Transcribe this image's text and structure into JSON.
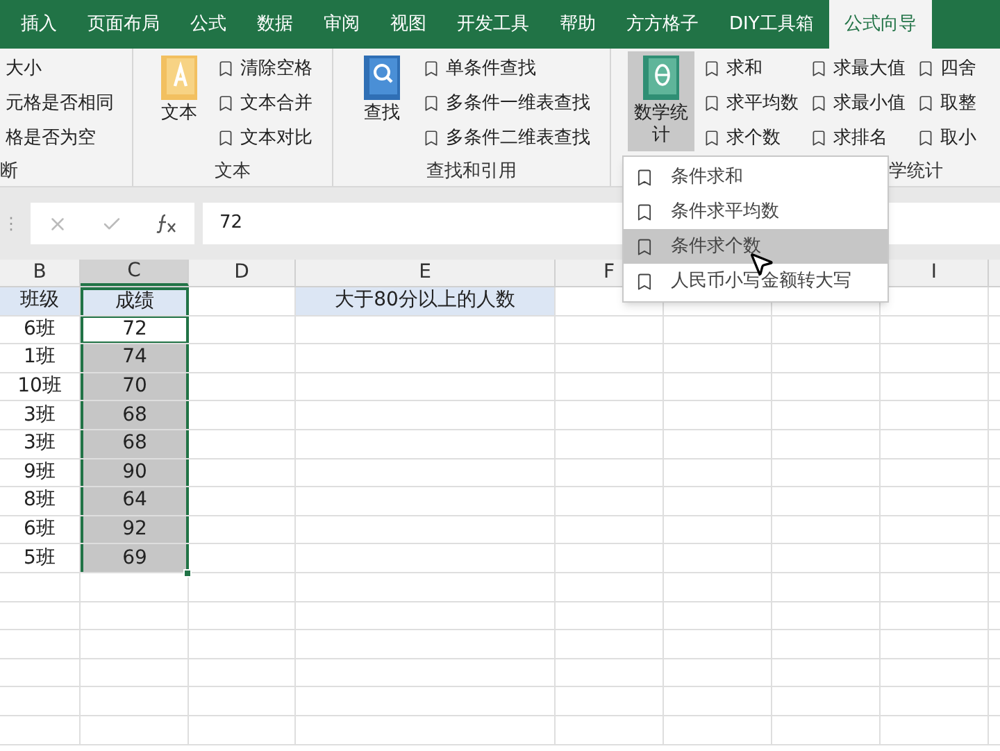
{
  "tabs": [
    {
      "label": "插入",
      "selected": false
    },
    {
      "label": "页面布局",
      "selected": false
    },
    {
      "label": "公式",
      "selected": false
    },
    {
      "label": "数据",
      "selected": false
    },
    {
      "label": "审阅",
      "selected": false
    },
    {
      "label": "视图",
      "selected": false
    },
    {
      "label": "开发工具",
      "selected": false
    },
    {
      "label": "帮助",
      "selected": false
    },
    {
      "label": "方方格子",
      "selected": false
    },
    {
      "label": "DIY工具箱",
      "selected": false
    },
    {
      "label": "公式向导",
      "selected": true
    }
  ],
  "ribbon": {
    "groups": [
      {
        "label": "断",
        "columns": [
          [
            "大小",
            "元格是否相同",
            "格是否为空"
          ]
        ],
        "plain": true
      },
      {
        "label": "文本",
        "big": {
          "label": "文本",
          "kind": "text",
          "pressed": false
        },
        "columns": [
          [
            "清除空格",
            "文本合并",
            "文本对比"
          ]
        ]
      },
      {
        "label": "查找和引用",
        "big": {
          "label": "查找",
          "kind": "search",
          "pressed": false
        },
        "columns": [
          [
            "单条件查找",
            "多条件一维表查找",
            "多条件二维表查找"
          ]
        ]
      },
      {
        "label": "学统计",
        "big": {
          "label": "数学统",
          "label2": "计",
          "kind": "theta",
          "pressed": true
        },
        "columns": [
          [
            "求和",
            "求平均数",
            "求个数"
          ],
          [
            "求最大值",
            "求最小值",
            "求排名"
          ],
          [
            "四舍",
            "取整",
            "取小"
          ]
        ]
      }
    ]
  },
  "formula_bar": {
    "grip": "⋮",
    "value": "72"
  },
  "columns": [
    {
      "label": "B",
      "selected": false
    },
    {
      "label": "C",
      "selected": true
    },
    {
      "label": "D",
      "selected": false
    },
    {
      "label": "E",
      "selected": false
    },
    {
      "label": "F",
      "selected": false
    },
    {
      "label": "I",
      "selected": false
    }
  ],
  "rows": [
    {
      "b": {
        "text": "班级",
        "highlight": true
      },
      "c": {
        "text": "成绩",
        "highlight": true,
        "selected": true,
        "active": false
      },
      "e": {
        "text": "大于80分以上的人数",
        "highlight": true
      }
    },
    {
      "b": {
        "text": "6班",
        "highlight": false
      },
      "c": {
        "text": "72",
        "highlight": false,
        "selected": true,
        "active": true
      }
    },
    {
      "b": {
        "text": "1班",
        "highlight": false
      },
      "c": {
        "text": "74",
        "highlight": false,
        "selected": true,
        "active": false
      }
    },
    {
      "b": {
        "text": "10班",
        "highlight": false
      },
      "c": {
        "text": "70",
        "highlight": false,
        "selected": true,
        "active": false
      }
    },
    {
      "b": {
        "text": "3班",
        "highlight": false
      },
      "c": {
        "text": "68",
        "highlight": false,
        "selected": true,
        "active": false
      }
    },
    {
      "b": {
        "text": "3班",
        "highlight": false
      },
      "c": {
        "text": "68",
        "highlight": false,
        "selected": true,
        "active": false
      }
    },
    {
      "b": {
        "text": "9班",
        "highlight": false
      },
      "c": {
        "text": "90",
        "highlight": false,
        "selected": true,
        "active": false
      }
    },
    {
      "b": {
        "text": "8班",
        "highlight": false
      },
      "c": {
        "text": "64",
        "highlight": false,
        "selected": true,
        "active": false
      }
    },
    {
      "b": {
        "text": "6班",
        "highlight": false
      },
      "c": {
        "text": "92",
        "highlight": false,
        "selected": true,
        "active": false
      }
    },
    {
      "b": {
        "text": "5班",
        "highlight": false
      },
      "c": {
        "text": "69",
        "highlight": false,
        "selected": true,
        "active": false
      }
    }
  ],
  "dropdown": {
    "items": [
      {
        "label": "条件求和",
        "selected": false
      },
      {
        "label": "条件求平均数",
        "selected": false
      },
      {
        "label": "条件求个数",
        "selected": true
      },
      {
        "label": "人民币小写金额转大写",
        "selected": false
      }
    ]
  }
}
